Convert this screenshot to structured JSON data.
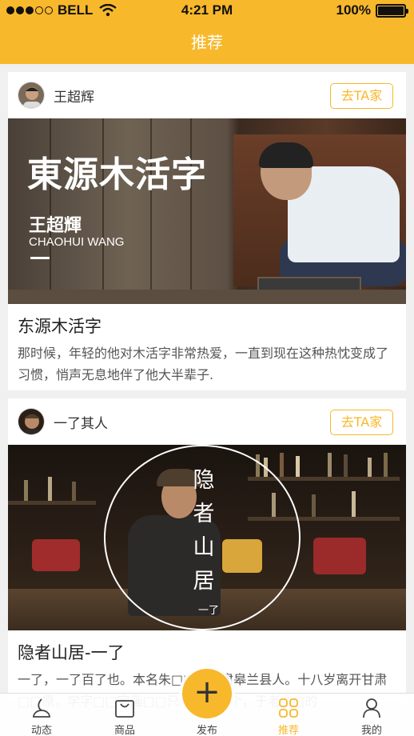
{
  "status_bar": {
    "carrier": "BELL",
    "time": "4:21 PM",
    "battery": "100%",
    "battery_level": 1.0
  },
  "nav": {
    "title": "推荐"
  },
  "posts": [
    {
      "author": "王超辉",
      "visit_label": "去TA家",
      "hero_title": "東源木活字",
      "hero_subtitle": "王超輝",
      "hero_en": "CHAOHUI WANG",
      "title": "东源木活字",
      "description": "那时候，年轻的他对木活字非常热爱，一直到现在这种热忱变成了习惯，悄声无息地伴了他大半辈子."
    },
    {
      "author": "一了其人",
      "visit_label": "去TA家",
      "hero_vertical": "隐者山居",
      "hero_small": "一了",
      "title": "隐者山居-一了",
      "description": "一了，一了百了也。本名朱□□，甘肃皋兰县人。十八岁离开甘肃□□原，学字□□字画□□只剩□□这个，于老□□的"
    }
  ],
  "tabbar": {
    "items": [
      {
        "label": "动态",
        "icon": "moments-icon"
      },
      {
        "label": "商品",
        "icon": "shopping-bag-icon"
      },
      {
        "label": "发布",
        "icon": "plus-icon"
      },
      {
        "label": "推荐",
        "icon": "grid-icon",
        "active": true
      },
      {
        "label": "我的",
        "icon": "user-icon"
      }
    ]
  },
  "colors": {
    "accent": "#f8b82c",
    "background": "#f0f0f0"
  }
}
